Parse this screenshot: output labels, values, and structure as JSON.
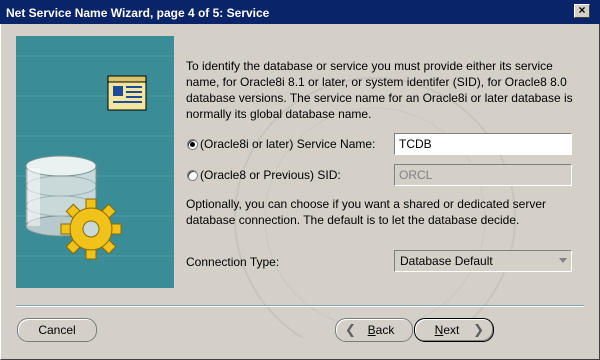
{
  "window": {
    "title": "Net Service Name Wizard, page 4 of 5: Service",
    "close_label": "×"
  },
  "intro_text": "To identify the database or service you must provide either its service name, for Oracle8i 8.1 or later, or system identifer (SID), for Oracle8 8.0 database versions. The service name for an Oracle8i or later database is normally its global database name.",
  "service_name": {
    "label": "(Oracle8i or later)  Service Name:",
    "value": "TCDB",
    "checked": true
  },
  "sid": {
    "label": "(Oracle8 or Previous) SID:",
    "value": "ORCL",
    "checked": false
  },
  "connection_text": "Optionally, you can choose if you want a shared or dedicated server database connection. The default is to let the database decide.",
  "connection_type": {
    "label": "Connection Type:",
    "selected": "Database Default"
  },
  "buttons": {
    "cancel": "Cancel",
    "back_u": "B",
    "back_rest": "ack",
    "next_u": "N",
    "next_rest": "ext"
  },
  "icons": {
    "graphic": "database-gear-icon",
    "back_arrow": "chevron-left-icon",
    "next_arrow": "chevron-right-icon"
  },
  "colors": {
    "title_bar": "#0a246a",
    "graphic_panel": "#3a8c96",
    "dialog_bg": "#d4d0c8"
  }
}
